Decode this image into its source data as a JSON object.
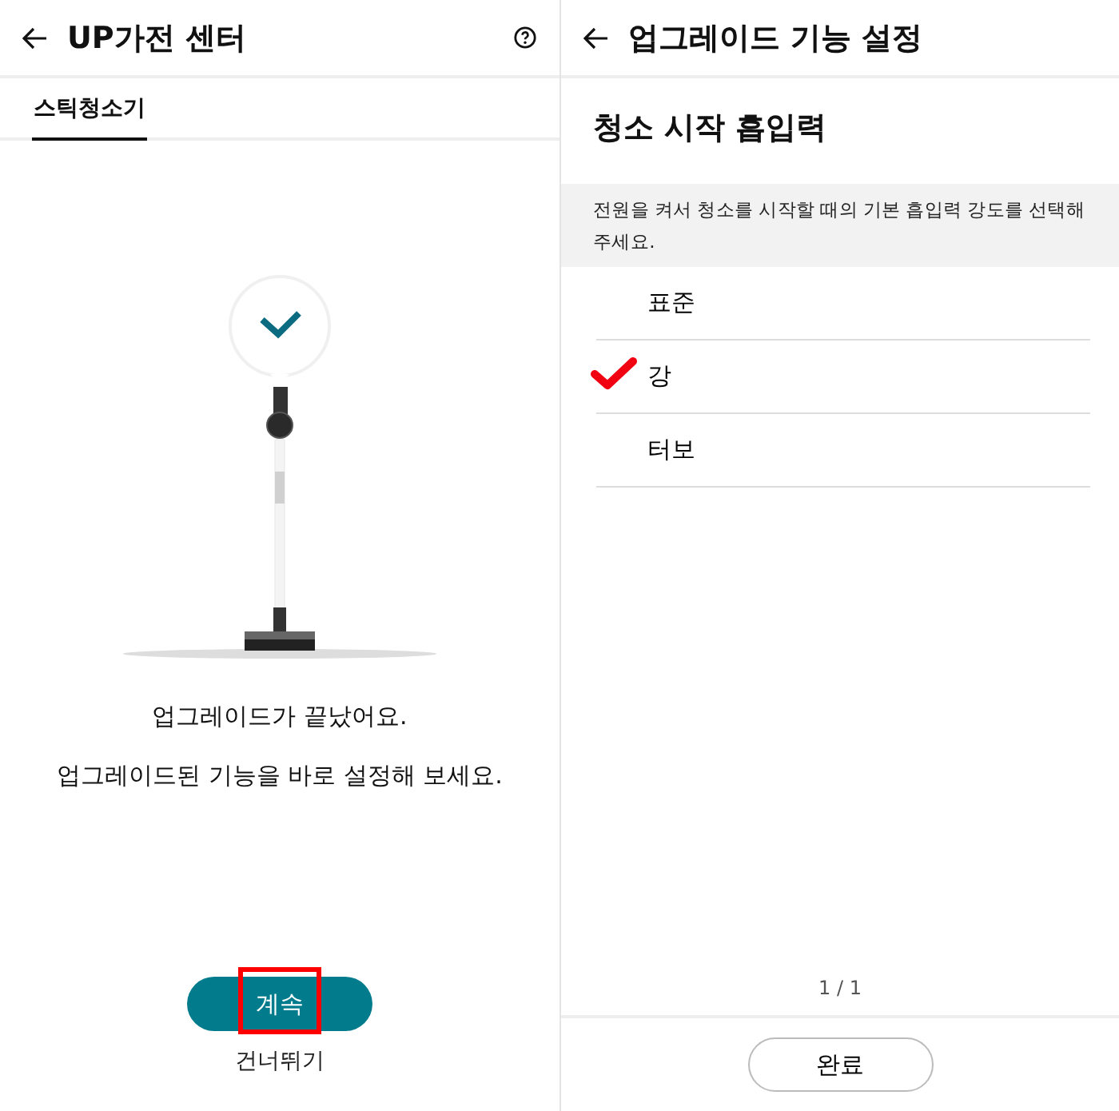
{
  "left": {
    "header": {
      "title": "UP가전 센터"
    },
    "tabs": [
      {
        "label": "스틱청소기",
        "selected": true
      }
    ],
    "messages": [
      "업그레이드가 끝났어요.",
      "업그레이드된 기능을 바로 설정해 보세요."
    ],
    "continue_button": {
      "label": "계속",
      "highlighted": true
    },
    "skip_link": "건너뛰기"
  },
  "right": {
    "header": {
      "title": "업그레이드 기능 설정"
    },
    "section_title": "청소 시작 흡입력",
    "description": "전원을 켜서 청소를 시작할 때의 기본 흡입력 강도를 선택해주세요.",
    "options": [
      {
        "label": "표준",
        "selected": false
      },
      {
        "label": "강",
        "selected": true
      },
      {
        "label": "터보",
        "selected": false
      }
    ],
    "page_indicator": "1 / 1",
    "done_button": "완료"
  }
}
